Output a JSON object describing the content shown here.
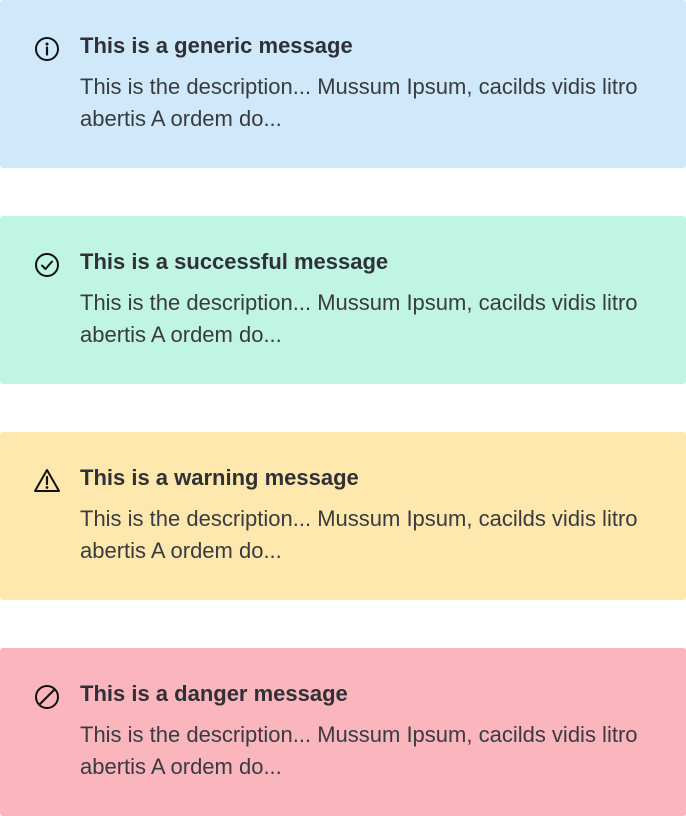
{
  "alerts": [
    {
      "kind": "generic",
      "icon": "info-circle-icon",
      "background": "#cfe9fb",
      "title": "This is a generic message",
      "description": "This is the description... Mussum Ipsum, cacilds vidis litro abertis A ordem do..."
    },
    {
      "kind": "success",
      "icon": "check-circle-icon",
      "background": "#bff5e2",
      "title": "This is a successful message",
      "description": "This is the description... Mussum Ipsum, cacilds vidis litro abertis A ordem do..."
    },
    {
      "kind": "warning",
      "icon": "warning-triangle-icon",
      "background": "#fee8ad",
      "title": "This is a warning message",
      "description": "This is the description... Mussum Ipsum, cacilds vidis litro abertis A ordem do..."
    },
    {
      "kind": "danger",
      "icon": "prohibited-circle-icon",
      "background": "#fab5bd",
      "title": "This is a danger message",
      "description": "This is the description... Mussum Ipsum, cacilds vidis litro abertis A ordem do..."
    }
  ],
  "colors": {
    "text": "#323232",
    "icon_stroke": "#111111"
  }
}
